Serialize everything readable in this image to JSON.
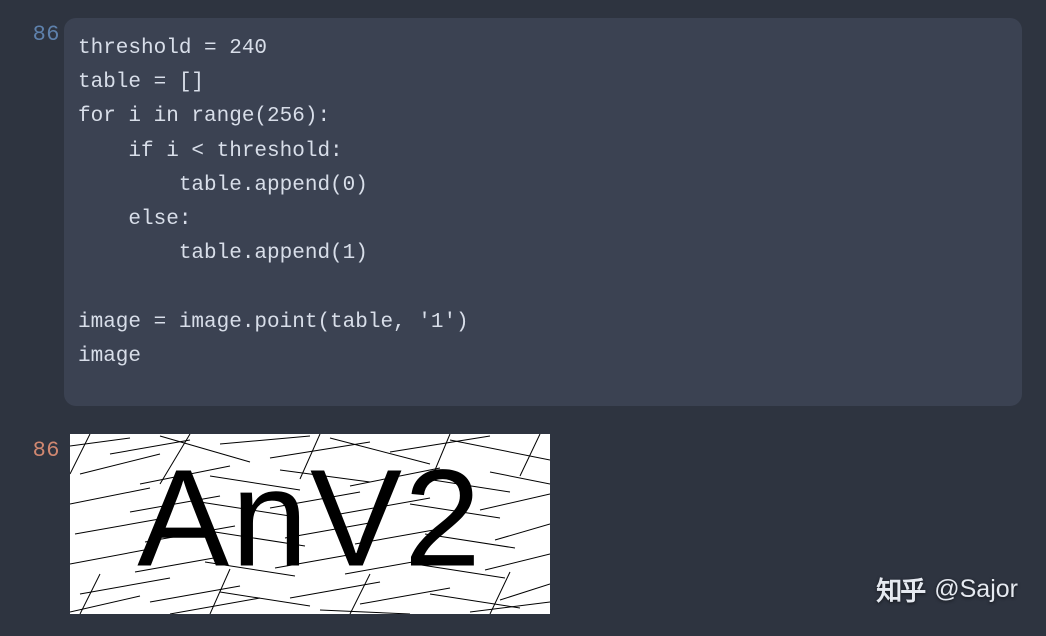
{
  "cells": {
    "input": {
      "prompt": "86",
      "code": "threshold = 240\ntable = []\nfor i in range(256):\n    if i < threshold:\n        table.append(0)\n    else:\n        table.append(1)\n\nimage = image.point(table, '1')\nimage"
    },
    "output": {
      "prompt": "86",
      "captcha_text": "AnV2"
    }
  },
  "watermark": {
    "logo": "知乎",
    "handle": "@Sajor"
  }
}
